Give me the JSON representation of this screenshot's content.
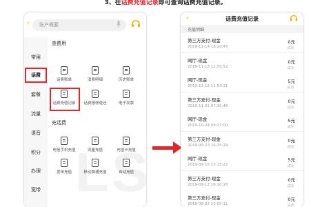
{
  "caption": {
    "prefix": "3、在",
    "highlight": "话费充值记录",
    "suffix": "即可查询话费充值记录。"
  },
  "left_phone": {
    "back_glyph": "‹",
    "search_placeholder": "账户概要",
    "sidebar": {
      "items": [
        {
          "label": "常用",
          "active": false
        },
        {
          "label": "话费",
          "active": true
        },
        {
          "label": "套餐",
          "active": false
        },
        {
          "label": "流量",
          "active": false
        },
        {
          "label": "语音",
          "active": false
        },
        {
          "label": "积分",
          "active": false
        },
        {
          "label": "办理",
          "active": false
        },
        {
          "label": "宽带",
          "active": false
        }
      ]
    },
    "section_query": {
      "title": "查费用",
      "items": [
        {
          "label": "话费账单",
          "icon": "bill-icon"
        },
        {
          "label": "消费明细",
          "icon": "detail-icon"
        },
        {
          "label": "历史账单",
          "icon": "history-bill-icon"
        },
        {
          "label": "话费充值记录",
          "icon": "recharge-record-icon"
        },
        {
          "label": "话费报停退还",
          "icon": "refund-icon"
        },
        {
          "label": "电子发票",
          "icon": "invoice-icon"
        }
      ]
    },
    "section_recharge": {
      "title": "充话费",
      "items": [
        {
          "label": "电信手机充值",
          "icon": "phone-recharge-icon"
        },
        {
          "label": "流量充值",
          "icon": "data-recharge-icon"
        },
        {
          "label": "充值卡充值",
          "icon": "card-recharge-icon"
        },
        {
          "label": "宽带充值",
          "icon": "broadband-recharge-icon"
        },
        {
          "label": "移动翼通充值",
          "icon": "mobile-recharge-icon"
        },
        {
          "label": "自动充值",
          "icon": "auto-recharge-icon"
        }
      ]
    },
    "watermark": "LSDY"
  },
  "right_phone": {
    "back_glyph": "‹",
    "title": "话费充值记录",
    "subtitle": "充值明细",
    "records": [
      {
        "type": "第三方支付-现金",
        "time": "2019-11-14 18:20:43",
        "amount": "0元",
        "status": "成功"
      },
      {
        "type": "网厅-现金",
        "time": "2019-11-13 12:55:52",
        "amount": "0元",
        "status": "成功"
      },
      {
        "type": "网厅-现金",
        "time": "2019-11-12 11:54:31",
        "amount": "5元",
        "status": "成功"
      },
      {
        "type": "第三方支付-现金",
        "time": "2019-11-01 07:30:48",
        "amount": "0元",
        "status": "成功"
      },
      {
        "type": "网厅-现金",
        "time": "2019-10-24 09:27:00",
        "amount": "5元",
        "status": "成功"
      },
      {
        "type": "第三方支付-现金",
        "time": "2019-09-23 16:25:29",
        "amount": "0元",
        "status": "成功"
      },
      {
        "type": "网厅-现金",
        "time": "2019-09-16 15:15:22",
        "amount": "5元",
        "status": "成功"
      },
      {
        "type": "第三方支付-现金",
        "time": "2019-09-12 16:10:18",
        "amount": "0元",
        "status": "成功"
      },
      {
        "type": "第三方支付-现金",
        "time": "2019-08-22 10:05:11",
        "amount": "0元",
        "status": "成功"
      }
    ]
  },
  "colors": {
    "accent": "#f1b400",
    "highlight_red": "#e4262a"
  }
}
